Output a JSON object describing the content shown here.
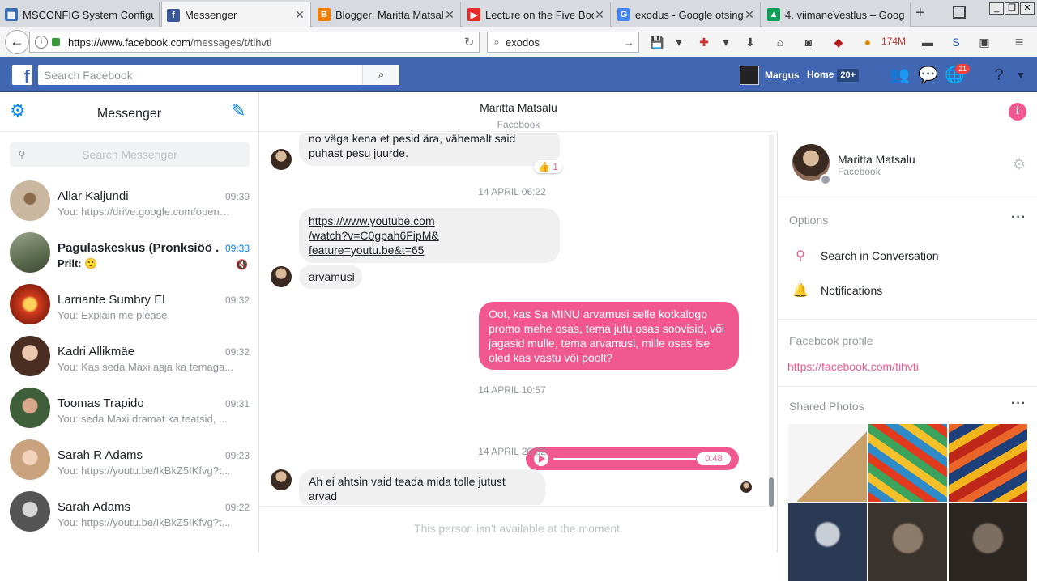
{
  "browser": {
    "tabs": [
      {
        "title": "MSCONFIG System Configu",
        "favicon": "ms-icon",
        "color": "#3c6eb4",
        "glyph": "▦"
      },
      {
        "title": "Messenger",
        "favicon": "facebook-icon",
        "color": "#3b5998",
        "glyph": "f"
      },
      {
        "title": "Blogger: Maritta Matsalu",
        "favicon": "blogger-icon",
        "color": "#f57d00",
        "glyph": "B"
      },
      {
        "title": "Lecture on the Five Book",
        "favicon": "youtube-icon",
        "color": "#e52d27",
        "glyph": "▶"
      },
      {
        "title": "exodus - Google otsing",
        "favicon": "google-icon",
        "color": "#4285f4",
        "glyph": "G"
      },
      {
        "title": "4. viimaneVestlus – Goog",
        "favicon": "drive-icon",
        "color": "#0f9d58",
        "glyph": "▲"
      }
    ],
    "new_tab_label": "+",
    "url_domain": "https://www.facebook.com",
    "url_path": "/messages/t/tihvti",
    "search_value": "exodos",
    "memory_label": "174M"
  },
  "facebook": {
    "search_placeholder": "Search Facebook",
    "user_name": "Margus",
    "home_label": "Home",
    "home_count": "20+",
    "notifications_count": "21"
  },
  "messenger": {
    "title": "Messenger",
    "search_placeholder": "Search Messenger",
    "conversations": [
      {
        "name": "Allar Kaljundi",
        "snippet": "You: https://drive.google.com/open?id=...",
        "time": "09:39",
        "unread": false
      },
      {
        "name": "Pagulaskeskus (Pronksiöö ...",
        "snippet": "Priit: 🙂",
        "time": "09:33",
        "unread": true
      },
      {
        "name": "Larriante Sumbry El",
        "snippet": "You: Explain me please",
        "time": "09:32",
        "unread": false
      },
      {
        "name": "Kadri Allikmäe",
        "snippet": "You: Kas seda Maxi asja ka temaga...",
        "time": "09:32",
        "unread": false
      },
      {
        "name": "Toomas Trapido",
        "snippet": "You: seda Maxi dramat ka teatsid, ...",
        "time": "09:31",
        "unread": false
      },
      {
        "name": "Sarah R Adams",
        "snippet": "You: https://youtu.be/IkBkZ5IKfvg?t...",
        "time": "09:23",
        "unread": false
      },
      {
        "name": "Sarah Adams",
        "snippet": "You: https://youtu.be/IkBkZ5IKfvg?t...",
        "time": "09:22",
        "unread": false
      }
    ]
  },
  "thread": {
    "contact_name": "Maritta Matsalu",
    "contact_sub": "Facebook",
    "messages": {
      "m1": "no väga kena et pesid ära, vähemalt said puhast pesu juurde.",
      "m1_reaction": "👍 1",
      "date1": "14 APRIL 06:22",
      "link_line1": "https://www.youtube.com",
      "link_line2": "/watch?v=C0gpah6FipM&",
      "link_line3": "feature=youtu.be&t=65",
      "m3": "arvamusi",
      "m4": "Oot, kas Sa MINU arvamusi selle kotkalogo promo mehe osas, tema jutu osas soovisid, või jagasid mulle, tema arvamusi, mille osas ise oled kas vastu või poolt?",
      "date2": "14 APRIL 10:57",
      "audio_duration": "0:48",
      "date3": "14 APRIL 20:32",
      "m5": "Ah ei ahtsin vaid teada mida tolle jutust arvad"
    },
    "unavailable_note": "This person isn't available at the moment."
  },
  "details": {
    "name": "Maritta Matsalu",
    "sub": "Facebook",
    "options_header": "Options",
    "opt_search": "Search in Conversation",
    "opt_notifications": "Notifications",
    "profile_header": "Facebook profile",
    "profile_link": "https://facebook.com/tihvti",
    "photos_header": "Shared Photos"
  },
  "colors": {
    "accent": "#f0588f",
    "fb_blue": "#4267b2",
    "messenger_blue": "#0084ff"
  }
}
